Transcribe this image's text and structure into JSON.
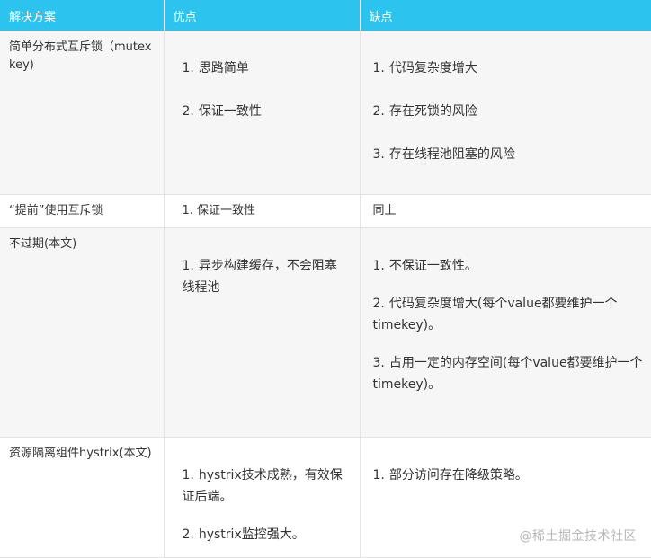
{
  "table": {
    "headers": [
      "解决方案",
      "优点",
      "缺点"
    ],
    "rows": [
      {
        "solution": "简单分布式互斥锁（mutex key)",
        "pros": [
          {
            "n": "1.",
            "text": "思路简单"
          },
          {
            "n": "2.",
            "text": "保证一致性"
          }
        ],
        "cons": [
          {
            "n": "1.",
            "text": "代码复杂度增大"
          },
          {
            "n": "2.",
            "text": "存在死锁的风险"
          },
          {
            "n": "3.",
            "text": "存在线程池阻塞的风险"
          }
        ]
      },
      {
        "solution": "“提前”使用互斥锁",
        "pros_text": "1. 保证一致性",
        "cons_text": "同上"
      },
      {
        "solution": "不过期(本文)",
        "pros": [
          {
            "n": "1.",
            "text": "异步构建缓存，不会阻塞线程池"
          }
        ],
        "cons": [
          {
            "n": "1.",
            "text": "不保证一致性。"
          },
          {
            "n": "2.",
            "text": "代码复杂度增大(每个value都要维护一个timekey)。"
          },
          {
            "n": "3.",
            "text": "占用一定的内存空间(每个value都要维护一个timekey)。"
          }
        ]
      },
      {
        "solution": "资源隔离组件hystrix(本文)",
        "pros": [
          {
            "n": "1.",
            "text": "hystrix技术成熟，有效保证后端。"
          },
          {
            "n": "2.",
            "text": "hystrix监控强大。"
          }
        ],
        "cons": [
          {
            "n": "1.",
            "text": "部分访问存在降级策略。"
          }
        ]
      }
    ]
  },
  "watermark": "@稀土掘金技术社区"
}
